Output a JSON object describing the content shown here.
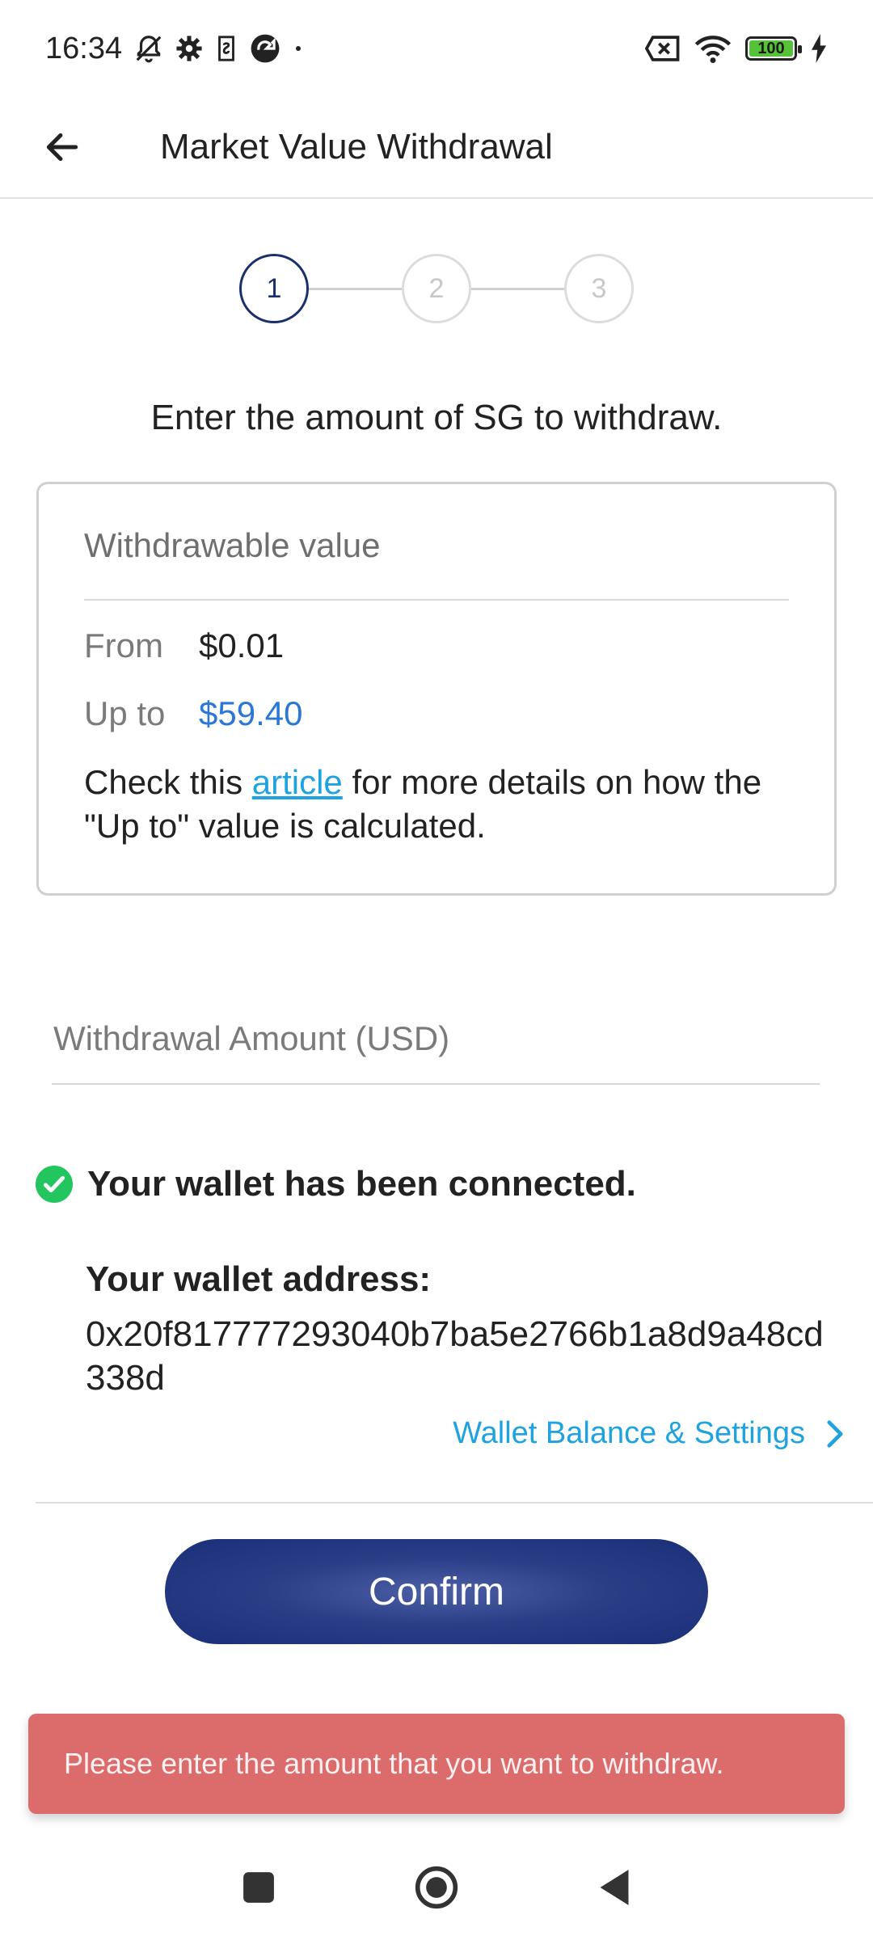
{
  "status_bar": {
    "time": "16:34",
    "battery_level": "100",
    "icons": [
      "bell-off-icon",
      "gear-icon",
      "sim-icon",
      "app-icon",
      "dot-icon",
      "no-sim-icon",
      "wifi-icon",
      "battery-icon",
      "charging-icon"
    ]
  },
  "app_bar": {
    "title": "Market Value Withdrawal"
  },
  "stepper": {
    "steps": [
      "1",
      "2",
      "3"
    ],
    "current_step": 1
  },
  "instruction": "Enter the amount of SG to withdraw.",
  "info_card": {
    "title": "Withdrawable value",
    "from_label": "From",
    "from_value": "$0.01",
    "upto_label": "Up to",
    "upto_value": "$59.40",
    "note_before": "Check this ",
    "note_link": "article",
    "note_after": " for more details on how the \"Up to\" value is calculated."
  },
  "amount_input": {
    "placeholder": "Withdrawal Amount (USD)",
    "value": ""
  },
  "wallet": {
    "status": "Your wallet has been connected.",
    "address_label": "Your wallet address:",
    "address": "0x20f817777293040b7ba5e2766b1a8d9a48cd338d",
    "settings_link": "Wallet Balance & Settings"
  },
  "confirm_label": "Confirm",
  "toast_message": "Please enter the amount that you want to withdraw.",
  "colors": {
    "accent_navy": "#1b2f79",
    "link_blue": "#1ea2e0",
    "value_blue": "#2a77d6",
    "success_green": "#22c55e",
    "toast_red": "#dc6b6b"
  }
}
